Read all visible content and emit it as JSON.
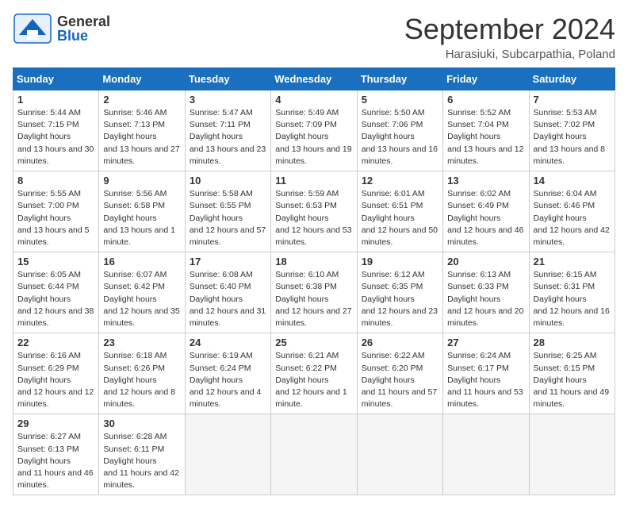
{
  "header": {
    "logo_general": "General",
    "logo_blue": "Blue",
    "month_title": "September 2024",
    "location": "Harasiuki, Subcarpathia, Poland"
  },
  "calendar": {
    "days_of_week": [
      "Sunday",
      "Monday",
      "Tuesday",
      "Wednesday",
      "Thursday",
      "Friday",
      "Saturday"
    ],
    "weeks": [
      [
        {
          "day": "",
          "empty": true
        },
        {
          "day": "",
          "empty": true
        },
        {
          "day": "",
          "empty": true
        },
        {
          "day": "",
          "empty": true
        },
        {
          "day": "",
          "empty": true
        },
        {
          "day": "",
          "empty": true
        },
        {
          "day": "",
          "empty": true
        }
      ]
    ]
  },
  "cells": [
    {
      "day": 1,
      "sunrise": "5:44 AM",
      "sunset": "7:15 PM",
      "daylight": "13 hours and 30 minutes."
    },
    {
      "day": 2,
      "sunrise": "5:46 AM",
      "sunset": "7:13 PM",
      "daylight": "13 hours and 27 minutes."
    },
    {
      "day": 3,
      "sunrise": "5:47 AM",
      "sunset": "7:11 PM",
      "daylight": "13 hours and 23 minutes."
    },
    {
      "day": 4,
      "sunrise": "5:49 AM",
      "sunset": "7:09 PM",
      "daylight": "13 hours and 19 minutes."
    },
    {
      "day": 5,
      "sunrise": "5:50 AM",
      "sunset": "7:06 PM",
      "daylight": "13 hours and 16 minutes."
    },
    {
      "day": 6,
      "sunrise": "5:52 AM",
      "sunset": "7:04 PM",
      "daylight": "13 hours and 12 minutes."
    },
    {
      "day": 7,
      "sunrise": "5:53 AM",
      "sunset": "7:02 PM",
      "daylight": "13 hours and 8 minutes."
    },
    {
      "day": 8,
      "sunrise": "5:55 AM",
      "sunset": "7:00 PM",
      "daylight": "13 hours and 5 minutes."
    },
    {
      "day": 9,
      "sunrise": "5:56 AM",
      "sunset": "6:58 PM",
      "daylight": "13 hours and 1 minute."
    },
    {
      "day": 10,
      "sunrise": "5:58 AM",
      "sunset": "6:55 PM",
      "daylight": "12 hours and 57 minutes."
    },
    {
      "day": 11,
      "sunrise": "5:59 AM",
      "sunset": "6:53 PM",
      "daylight": "12 hours and 53 minutes."
    },
    {
      "day": 12,
      "sunrise": "6:01 AM",
      "sunset": "6:51 PM",
      "daylight": "12 hours and 50 minutes."
    },
    {
      "day": 13,
      "sunrise": "6:02 AM",
      "sunset": "6:49 PM",
      "daylight": "12 hours and 46 minutes."
    },
    {
      "day": 14,
      "sunrise": "6:04 AM",
      "sunset": "6:46 PM",
      "daylight": "12 hours and 42 minutes."
    },
    {
      "day": 15,
      "sunrise": "6:05 AM",
      "sunset": "6:44 PM",
      "daylight": "12 hours and 38 minutes."
    },
    {
      "day": 16,
      "sunrise": "6:07 AM",
      "sunset": "6:42 PM",
      "daylight": "12 hours and 35 minutes."
    },
    {
      "day": 17,
      "sunrise": "6:08 AM",
      "sunset": "6:40 PM",
      "daylight": "12 hours and 31 minutes."
    },
    {
      "day": 18,
      "sunrise": "6:10 AM",
      "sunset": "6:38 PM",
      "daylight": "12 hours and 27 minutes."
    },
    {
      "day": 19,
      "sunrise": "6:12 AM",
      "sunset": "6:35 PM",
      "daylight": "12 hours and 23 minutes."
    },
    {
      "day": 20,
      "sunrise": "6:13 AM",
      "sunset": "6:33 PM",
      "daylight": "12 hours and 20 minutes."
    },
    {
      "day": 21,
      "sunrise": "6:15 AM",
      "sunset": "6:31 PM",
      "daylight": "12 hours and 16 minutes."
    },
    {
      "day": 22,
      "sunrise": "6:16 AM",
      "sunset": "6:29 PM",
      "daylight": "12 hours and 12 minutes."
    },
    {
      "day": 23,
      "sunrise": "6:18 AM",
      "sunset": "6:26 PM",
      "daylight": "12 hours and 8 minutes."
    },
    {
      "day": 24,
      "sunrise": "6:19 AM",
      "sunset": "6:24 PM",
      "daylight": "12 hours and 4 minutes."
    },
    {
      "day": 25,
      "sunrise": "6:21 AM",
      "sunset": "6:22 PM",
      "daylight": "12 hours and 1 minute."
    },
    {
      "day": 26,
      "sunrise": "6:22 AM",
      "sunset": "6:20 PM",
      "daylight": "11 hours and 57 minutes."
    },
    {
      "day": 27,
      "sunrise": "6:24 AM",
      "sunset": "6:17 PM",
      "daylight": "11 hours and 53 minutes."
    },
    {
      "day": 28,
      "sunrise": "6:25 AM",
      "sunset": "6:15 PM",
      "daylight": "11 hours and 49 minutes."
    },
    {
      "day": 29,
      "sunrise": "6:27 AM",
      "sunset": "6:13 PM",
      "daylight": "11 hours and 46 minutes."
    },
    {
      "day": 30,
      "sunrise": "6:28 AM",
      "sunset": "6:11 PM",
      "daylight": "11 hours and 42 minutes."
    }
  ]
}
